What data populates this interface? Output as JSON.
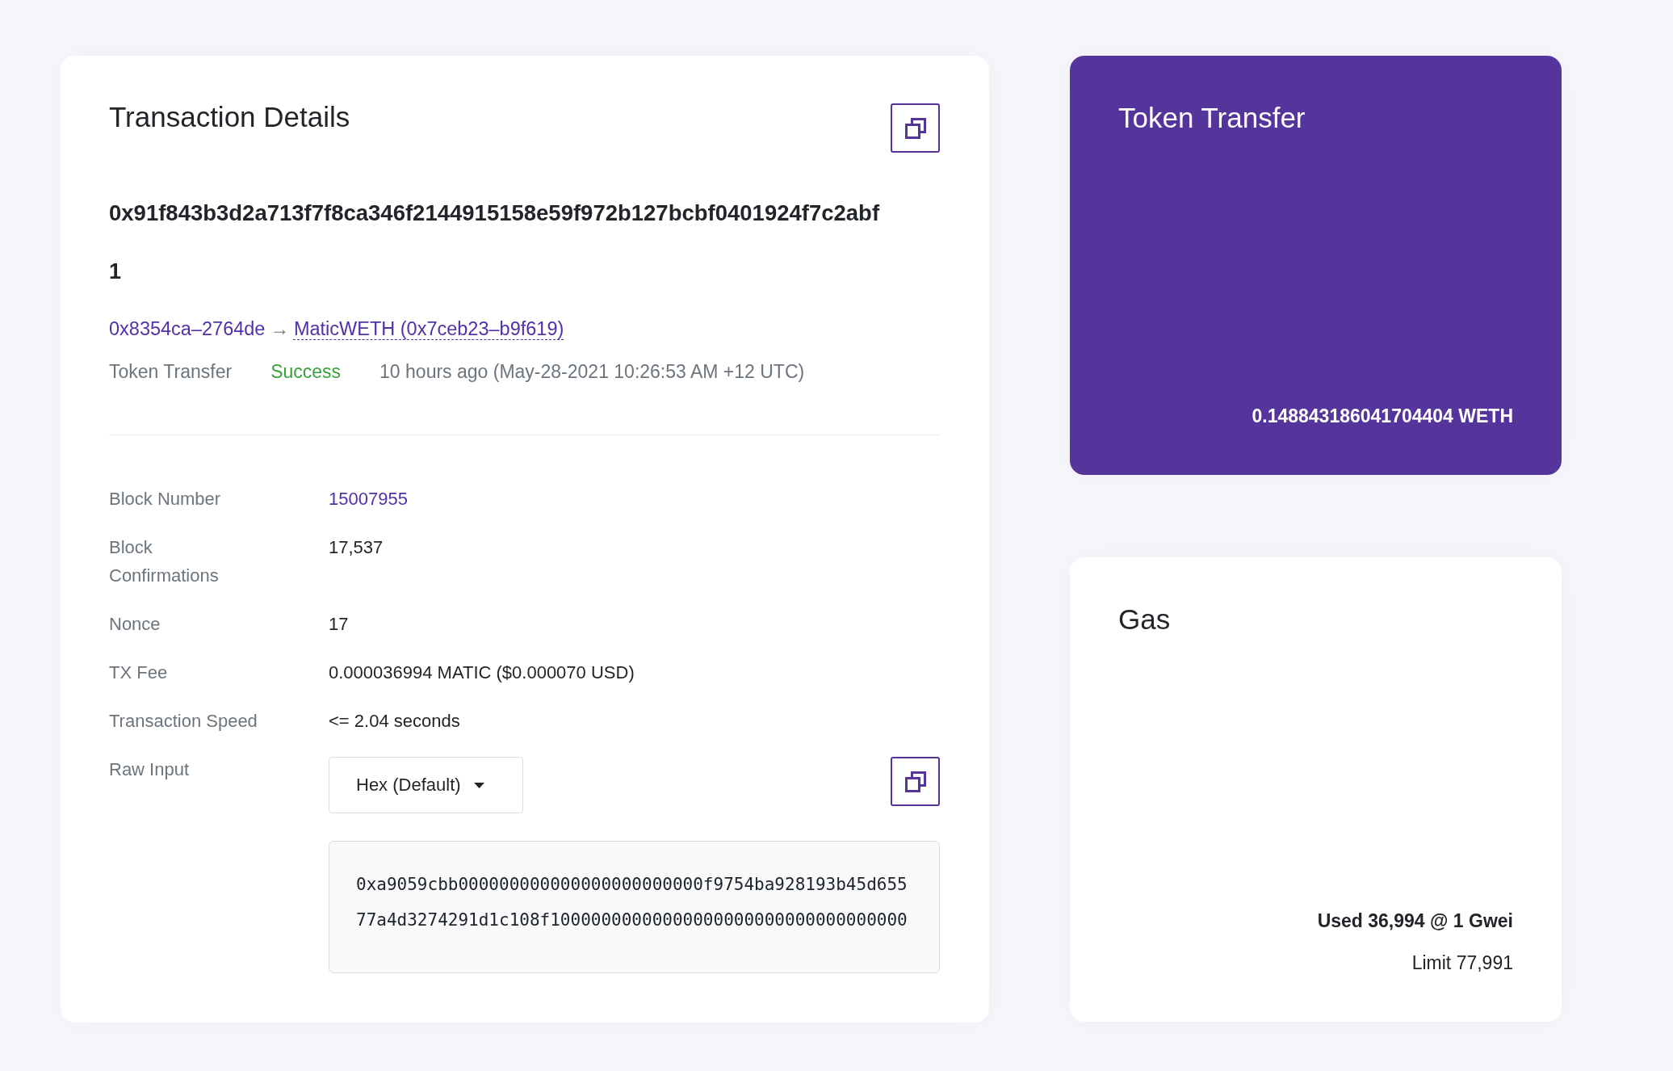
{
  "transaction_card": {
    "title": "Transaction Details",
    "hash": "0x91f843b3d2a713f7f8ca346f2144915158e59f972b127bcbf0401924f7c2abf",
    "index": "1",
    "transfer": {
      "from": "0x8354ca–2764de",
      "arrow": "→",
      "to": "MaticWETH (0x7ceb23–b9f619)"
    },
    "type": "Token Transfer",
    "status": {
      "label": "Success",
      "kind": "success"
    },
    "timestamp": "10 hours ago (May-28-2021 10:26:53 AM +12 UTC)",
    "rows": [
      {
        "label": "Block Number",
        "value": "15007955",
        "kind": "link"
      },
      {
        "label": "Block Confirmations",
        "value": "17,537",
        "kind": "text"
      },
      {
        "label": "Nonce",
        "value": "17",
        "kind": "text"
      },
      {
        "label": "TX Fee",
        "value": "0.000036994 MATIC ($0.000070 USD)",
        "kind": "text"
      },
      {
        "label": "Transaction Speed",
        "value": "<= 2.04 seconds",
        "kind": "text"
      }
    ],
    "raw_input": {
      "label": "Raw Input",
      "format": "Hex (Default)",
      "lines": [
        "0xa9059cbb000000000000000000000000f9754ba928193b45d655",
        "77a4d3274291d1c108f10000000000000000000000000000000000"
      ]
    }
  },
  "token_transfer_card": {
    "title": "Token Transfer",
    "amount": "0.148843186041704404 WETH"
  },
  "gas_card": {
    "title": "Gas",
    "used": "Used 36,994 @ 1 Gwei",
    "limit": "Limit 77,991"
  }
}
